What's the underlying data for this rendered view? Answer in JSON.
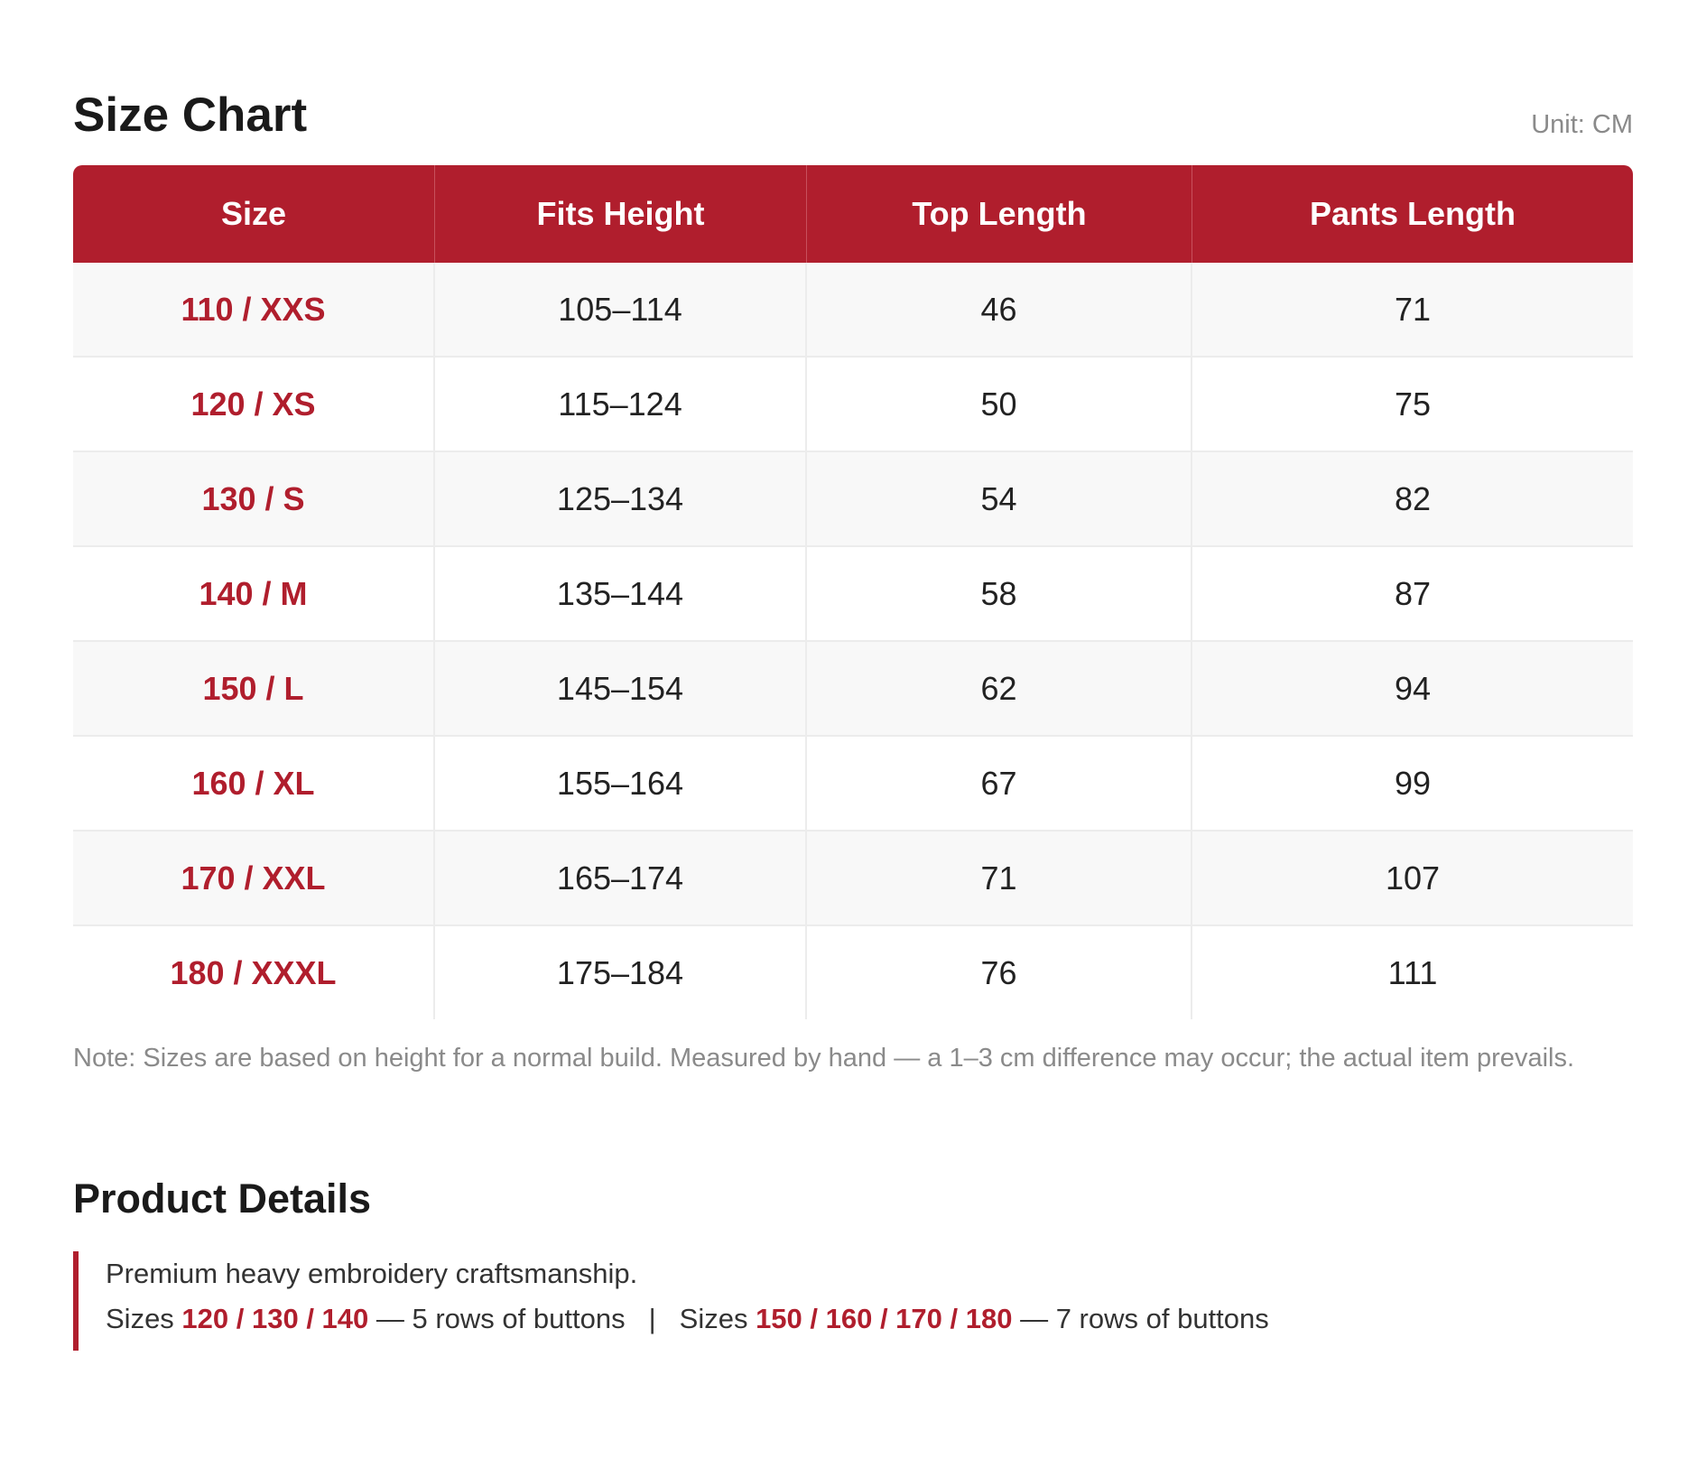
{
  "size_chart": {
    "title": "Size Chart",
    "unit": "Unit: CM",
    "columns": [
      "Size",
      "Fits Height",
      "Top Length",
      "Pants Length"
    ],
    "rows": [
      {
        "size": "110 / XXS",
        "height": "105–114",
        "top": "46",
        "pants": "71"
      },
      {
        "size": "120 / XS",
        "height": "115–124",
        "top": "50",
        "pants": "75"
      },
      {
        "size": "130 / S",
        "height": "125–134",
        "top": "54",
        "pants": "82"
      },
      {
        "size": "140 / M",
        "height": "135–144",
        "top": "58",
        "pants": "87"
      },
      {
        "size": "150 / L",
        "height": "145–154",
        "top": "62",
        "pants": "94"
      },
      {
        "size": "160 / XL",
        "height": "155–164",
        "top": "67",
        "pants": "99"
      },
      {
        "size": "170 / XXL",
        "height": "165–174",
        "top": "71",
        "pants": "107"
      },
      {
        "size": "180 / XXXL",
        "height": "175–184",
        "top": "76",
        "pants": "111"
      }
    ],
    "note": "Note: Sizes are based on height for a normal build. Measured by hand — a 1–3 cm difference may occur; the actual item prevails."
  },
  "product_details": {
    "title": "Product Details",
    "line1": "Premium heavy embroidery craftsmanship.",
    "group1_prefix": "Sizes ",
    "group1_sizes": "120 / 130 / 140",
    "group1_suffix": " — 5 rows of buttons",
    "separator": "|",
    "group2_prefix": "Sizes ",
    "group2_sizes": "150 / 160 / 170 / 180",
    "group2_suffix": " — 7 rows of buttons"
  },
  "colors": {
    "accent": "#b01e2d",
    "row_alt": "#f8f8f8",
    "muted_text": "#8a8a8a"
  }
}
